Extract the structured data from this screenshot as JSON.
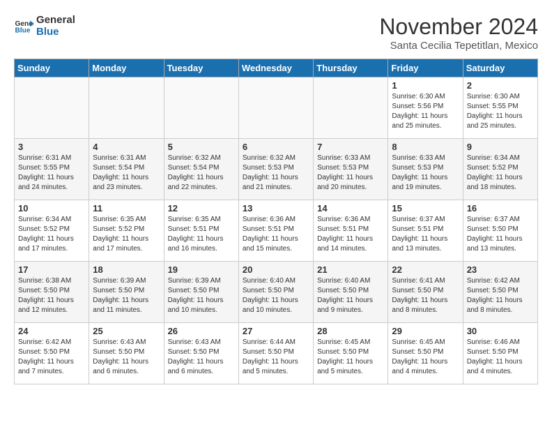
{
  "logo": {
    "line1": "General",
    "line2": "Blue"
  },
  "title": "November 2024",
  "location": "Santa Cecilia Tepetitlan, Mexico",
  "weekdays": [
    "Sunday",
    "Monday",
    "Tuesday",
    "Wednesday",
    "Thursday",
    "Friday",
    "Saturday"
  ],
  "weeks": [
    [
      {
        "day": "",
        "info": ""
      },
      {
        "day": "",
        "info": ""
      },
      {
        "day": "",
        "info": ""
      },
      {
        "day": "",
        "info": ""
      },
      {
        "day": "",
        "info": ""
      },
      {
        "day": "1",
        "info": "Sunrise: 6:30 AM\nSunset: 5:56 PM\nDaylight: 11 hours and 25 minutes."
      },
      {
        "day": "2",
        "info": "Sunrise: 6:30 AM\nSunset: 5:55 PM\nDaylight: 11 hours and 25 minutes."
      }
    ],
    [
      {
        "day": "3",
        "info": "Sunrise: 6:31 AM\nSunset: 5:55 PM\nDaylight: 11 hours and 24 minutes."
      },
      {
        "day": "4",
        "info": "Sunrise: 6:31 AM\nSunset: 5:54 PM\nDaylight: 11 hours and 23 minutes."
      },
      {
        "day": "5",
        "info": "Sunrise: 6:32 AM\nSunset: 5:54 PM\nDaylight: 11 hours and 22 minutes."
      },
      {
        "day": "6",
        "info": "Sunrise: 6:32 AM\nSunset: 5:53 PM\nDaylight: 11 hours and 21 minutes."
      },
      {
        "day": "7",
        "info": "Sunrise: 6:33 AM\nSunset: 5:53 PM\nDaylight: 11 hours and 20 minutes."
      },
      {
        "day": "8",
        "info": "Sunrise: 6:33 AM\nSunset: 5:53 PM\nDaylight: 11 hours and 19 minutes."
      },
      {
        "day": "9",
        "info": "Sunrise: 6:34 AM\nSunset: 5:52 PM\nDaylight: 11 hours and 18 minutes."
      }
    ],
    [
      {
        "day": "10",
        "info": "Sunrise: 6:34 AM\nSunset: 5:52 PM\nDaylight: 11 hours and 17 minutes."
      },
      {
        "day": "11",
        "info": "Sunrise: 6:35 AM\nSunset: 5:52 PM\nDaylight: 11 hours and 17 minutes."
      },
      {
        "day": "12",
        "info": "Sunrise: 6:35 AM\nSunset: 5:51 PM\nDaylight: 11 hours and 16 minutes."
      },
      {
        "day": "13",
        "info": "Sunrise: 6:36 AM\nSunset: 5:51 PM\nDaylight: 11 hours and 15 minutes."
      },
      {
        "day": "14",
        "info": "Sunrise: 6:36 AM\nSunset: 5:51 PM\nDaylight: 11 hours and 14 minutes."
      },
      {
        "day": "15",
        "info": "Sunrise: 6:37 AM\nSunset: 5:51 PM\nDaylight: 11 hours and 13 minutes."
      },
      {
        "day": "16",
        "info": "Sunrise: 6:37 AM\nSunset: 5:50 PM\nDaylight: 11 hours and 13 minutes."
      }
    ],
    [
      {
        "day": "17",
        "info": "Sunrise: 6:38 AM\nSunset: 5:50 PM\nDaylight: 11 hours and 12 minutes."
      },
      {
        "day": "18",
        "info": "Sunrise: 6:39 AM\nSunset: 5:50 PM\nDaylight: 11 hours and 11 minutes."
      },
      {
        "day": "19",
        "info": "Sunrise: 6:39 AM\nSunset: 5:50 PM\nDaylight: 11 hours and 10 minutes."
      },
      {
        "day": "20",
        "info": "Sunrise: 6:40 AM\nSunset: 5:50 PM\nDaylight: 11 hours and 10 minutes."
      },
      {
        "day": "21",
        "info": "Sunrise: 6:40 AM\nSunset: 5:50 PM\nDaylight: 11 hours and 9 minutes."
      },
      {
        "day": "22",
        "info": "Sunrise: 6:41 AM\nSunset: 5:50 PM\nDaylight: 11 hours and 8 minutes."
      },
      {
        "day": "23",
        "info": "Sunrise: 6:42 AM\nSunset: 5:50 PM\nDaylight: 11 hours and 8 minutes."
      }
    ],
    [
      {
        "day": "24",
        "info": "Sunrise: 6:42 AM\nSunset: 5:50 PM\nDaylight: 11 hours and 7 minutes."
      },
      {
        "day": "25",
        "info": "Sunrise: 6:43 AM\nSunset: 5:50 PM\nDaylight: 11 hours and 6 minutes."
      },
      {
        "day": "26",
        "info": "Sunrise: 6:43 AM\nSunset: 5:50 PM\nDaylight: 11 hours and 6 minutes."
      },
      {
        "day": "27",
        "info": "Sunrise: 6:44 AM\nSunset: 5:50 PM\nDaylight: 11 hours and 5 minutes."
      },
      {
        "day": "28",
        "info": "Sunrise: 6:45 AM\nSunset: 5:50 PM\nDaylight: 11 hours and 5 minutes."
      },
      {
        "day": "29",
        "info": "Sunrise: 6:45 AM\nSunset: 5:50 PM\nDaylight: 11 hours and 4 minutes."
      },
      {
        "day": "30",
        "info": "Sunrise: 6:46 AM\nSunset: 5:50 PM\nDaylight: 11 hours and 4 minutes."
      }
    ]
  ]
}
